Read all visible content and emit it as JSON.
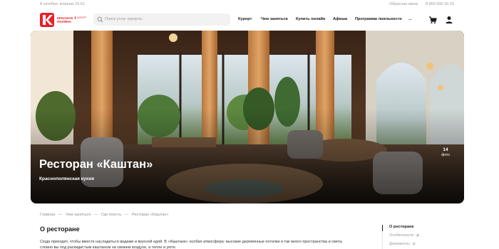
{
  "utility": {
    "date": "8 октября, вторник 15:51",
    "feedback": "Обратная связь",
    "phone": "8 800 550 20 20"
  },
  "logo": {
    "line1": "КРАСНАЯ",
    "line2": "ПОЛЯНА",
    "sub": "КУРОРТ"
  },
  "search": {
    "placeholder": "Поиск услуг курорта..."
  },
  "nav": {
    "items": [
      "Курорт",
      "Чем заняться",
      "Купить онлайн",
      "Афиша",
      "Программа лояльности",
      "..."
    ]
  },
  "hero": {
    "title": "Ресторан «Каштан»",
    "cuisine": "Краснополянская кухня",
    "photos_count": "14",
    "photos_label": "фото"
  },
  "breadcrumb": [
    "Главная",
    "—",
    "Чем заняться",
    "—",
    "Где поесть",
    "—",
    "Ресторан «Каштан»"
  ],
  "about": {
    "title": "О ресторане",
    "text": "Сюда приходят, чтобы вместе насладиться видами и вкусной едой. В «Каштане» особая атмосфера: высокие деревянные потолки и так много пространства и света, словно вы под раскидистым каштаном на свежем воздухе, а тепле и уюте."
  },
  "toc": {
    "items": [
      {
        "label": "О ресторане",
        "badge": ""
      },
      {
        "label": "Особенности",
        "badge": "6"
      },
      {
        "label": "Документы",
        "badge": "3"
      }
    ]
  },
  "colors": {
    "brand": "#e8202a"
  }
}
